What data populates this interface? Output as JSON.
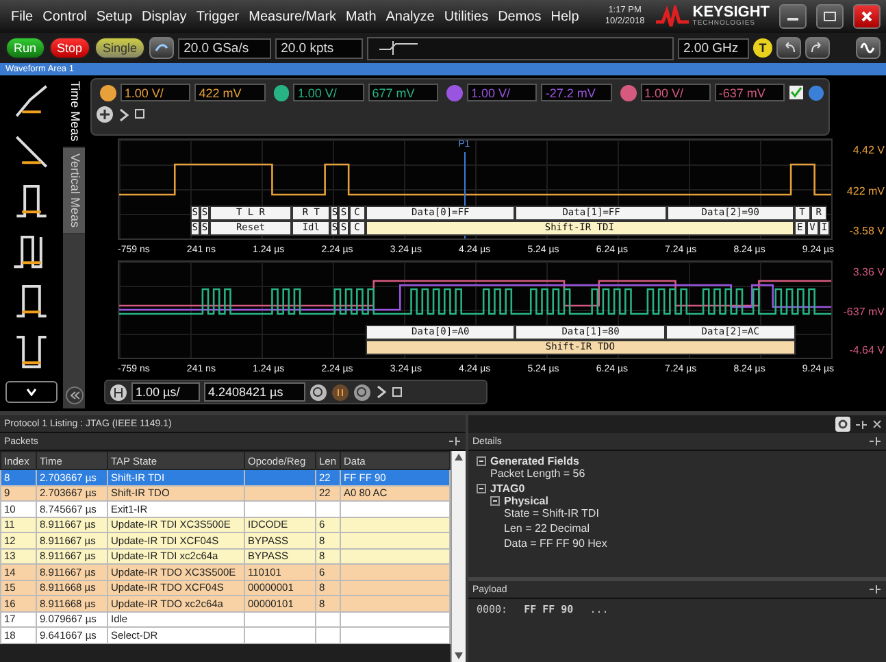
{
  "menu": {
    "items": [
      "File",
      "Control",
      "Setup",
      "Display",
      "Trigger",
      "Measure/Mark",
      "Math",
      "Analyze",
      "Utilities",
      "Demos",
      "Help"
    ]
  },
  "clock": {
    "time": "1:17 PM",
    "date": "10/2/2018"
  },
  "logo": {
    "name": "KEYSIGHT",
    "tagline": "TECHNOLOGIES"
  },
  "toolbar": {
    "buttons": [
      {
        "label": "Run",
        "kind": "run"
      },
      {
        "label": "Stop",
        "kind": "stop"
      },
      {
        "label": "Single",
        "kind": "single"
      }
    ],
    "sample_rate": "20.0 GSa/s",
    "memory_depth": "20.0 kpts",
    "bandwidth": "2.00 GHz",
    "trigger_badge": "T"
  },
  "waveform_area": {
    "title": "Waveform Area 1"
  },
  "side_tabs": [
    {
      "label": "Time Meas",
      "selected": true
    },
    {
      "label": "Vertical Meas",
      "selected": false
    }
  ],
  "channels": [
    {
      "scale": "1.00 V/",
      "offset": "422 mV",
      "color": "#e8a03a"
    },
    {
      "scale": "1.00 V/",
      "offset": "677 mV",
      "color": "#27b383"
    },
    {
      "scale": "1.00 V/",
      "offset": "-27.2 mV",
      "color": "#9a55e0"
    },
    {
      "scale": "1.00 V/",
      "offset": "-637 mV",
      "color": "#d65a80"
    }
  ],
  "marker": {
    "label": "P1"
  },
  "plots": [
    {
      "axis": [
        "4.42 V",
        "422 mV",
        "-3.58 V"
      ],
      "color": "#e8a03a",
      "time_ticks": [
        "-759 ns",
        "241 ns",
        "1.24 µs",
        "2.24 µs",
        "3.24 µs",
        "4.24 µs",
        "5.24 µs",
        "6.24 µs",
        "7.24 µs",
        "8.24 µs",
        "9.24 µs"
      ],
      "decode": [
        [
          {
            "text": "S",
            "highlighted": false
          },
          {
            "text": "S",
            "highlighted": false
          },
          {
            "text": "T L R",
            "highlighted": false
          },
          {
            "text": "R T",
            "highlighted": false
          },
          {
            "text": "S",
            "highlighted": false
          },
          {
            "text": "S",
            "highlighted": false
          },
          {
            "text": "C",
            "highlighted": false
          },
          {
            "text": "Data[0]=FF",
            "highlighted": false
          },
          {
            "text": "Data[1]=FF",
            "highlighted": false
          },
          {
            "text": "Data[2]=90",
            "highlighted": false
          },
          {
            "text": "T",
            "highlighted": false
          },
          {
            "text": "R",
            "highlighted": false
          }
        ],
        [
          {
            "text": "S",
            "highlighted": false
          },
          {
            "text": "S",
            "highlighted": false
          },
          {
            "text": "Reset",
            "highlighted": false
          },
          {
            "text": "Idl",
            "highlighted": false
          },
          {
            "text": "S",
            "highlighted": false
          },
          {
            "text": "S",
            "highlighted": false
          },
          {
            "text": "C",
            "highlighted": false
          },
          {
            "text": "Shift-IR TDI",
            "highlighted": true
          },
          {
            "text": "E",
            "highlighted": false
          },
          {
            "text": "V",
            "highlighted": false
          },
          {
            "text": "I",
            "highlighted": false
          }
        ]
      ]
    },
    {
      "axis": [
        "3.36 V",
        "-637 mV",
        "-4.64 V"
      ],
      "color": "#d65a80",
      "time_ticks": [
        "-759 ns",
        "241 ns",
        "1.24 µs",
        "2.24 µs",
        "3.24 µs",
        "4.24 µs",
        "5.24 µs",
        "6.24 µs",
        "7.24 µs",
        "8.24 µs",
        "9.24 µs"
      ],
      "decode": [
        [
          {
            "text": "Data[0]=A0",
            "highlighted": false
          },
          {
            "text": "Data[1]=80",
            "highlighted": false
          },
          {
            "text": "Data[2]=AC",
            "highlighted": false
          }
        ],
        [
          {
            "text": "Shift-IR TDO",
            "highlighted": true
          }
        ]
      ]
    }
  ],
  "horizontal": {
    "scale": "1.00 µs/",
    "position": "4.2408421 µs"
  },
  "listing": {
    "title": "Protocol 1 Listing : JTAG (IEEE 1149.1)",
    "section": "Packets",
    "columns": [
      "Index",
      "Time",
      "TAP State",
      "Opcode/Reg",
      "Len",
      "Data"
    ],
    "rows": [
      {
        "cells": [
          "8",
          "2.703667 µs",
          "Shift-IR TDI",
          "",
          "22",
          "FF FF 90"
        ],
        "selected": true
      },
      {
        "cells": [
          "9",
          "2.703667 µs",
          "Shift-IR TDO",
          "",
          "22",
          "A0 80 AC"
        ],
        "selected": false,
        "color": "#f8d2a4"
      },
      {
        "cells": [
          "10",
          "8.745667 µs",
          "Exit1-IR",
          "",
          "",
          ""
        ],
        "selected": false,
        "color": "#ffffff"
      },
      {
        "cells": [
          "11",
          "8.911667 µs",
          "Update-IR TDI XC3S500E",
          "IDCODE",
          "6",
          ""
        ],
        "selected": false,
        "color": "#fcf5c2"
      },
      {
        "cells": [
          "12",
          "8.911667 µs",
          "Update-IR TDI XCF04S",
          "BYPASS",
          "8",
          ""
        ],
        "selected": false,
        "color": "#fcf5c2"
      },
      {
        "cells": [
          "13",
          "8.911667 µs",
          "Update-IR TDI xc2c64a",
          "BYPASS",
          "8",
          ""
        ],
        "selected": false,
        "color": "#fcf5c2"
      },
      {
        "cells": [
          "14",
          "8.911667 µs",
          "Update-IR TDO XC3S500E",
          "110101",
          "6",
          ""
        ],
        "selected": false,
        "color": "#f8d2a4"
      },
      {
        "cells": [
          "15",
          "8.911668 µs",
          "Update-IR TDO XCF04S",
          "00000001",
          "8",
          ""
        ],
        "selected": false,
        "color": "#f8d2a4"
      },
      {
        "cells": [
          "16",
          "8.911668 µs",
          "Update-IR TDO xc2c64a",
          "00000101",
          "8",
          ""
        ],
        "selected": false,
        "color": "#f8d2a4"
      },
      {
        "cells": [
          "17",
          "9.079667 µs",
          "Idle",
          "",
          "",
          ""
        ],
        "selected": false,
        "color": "#ffffff"
      },
      {
        "cells": [
          "18",
          "9.641667 µs",
          "Select-DR",
          "",
          "",
          ""
        ],
        "selected": false,
        "color": "#ffffff"
      }
    ]
  },
  "details": {
    "title": "Details",
    "tree": [
      {
        "label": "Generated Fields",
        "expanded": true,
        "children": [
          {
            "label": "Packet Length = 56"
          }
        ]
      },
      {
        "label": "JTAG0",
        "expanded": true,
        "children": [
          {
            "label": "Physical",
            "expanded": true,
            "children": [
              {
                "label": "State = Shift-IR TDI"
              },
              {
                "label": "Len = 22 Decimal"
              },
              {
                "label": "Data = FF FF 90 Hex"
              }
            ]
          }
        ]
      }
    ]
  },
  "payload": {
    "title": "Payload",
    "address": "0000:",
    "bytes": "FF FF 90",
    "more": "..."
  }
}
